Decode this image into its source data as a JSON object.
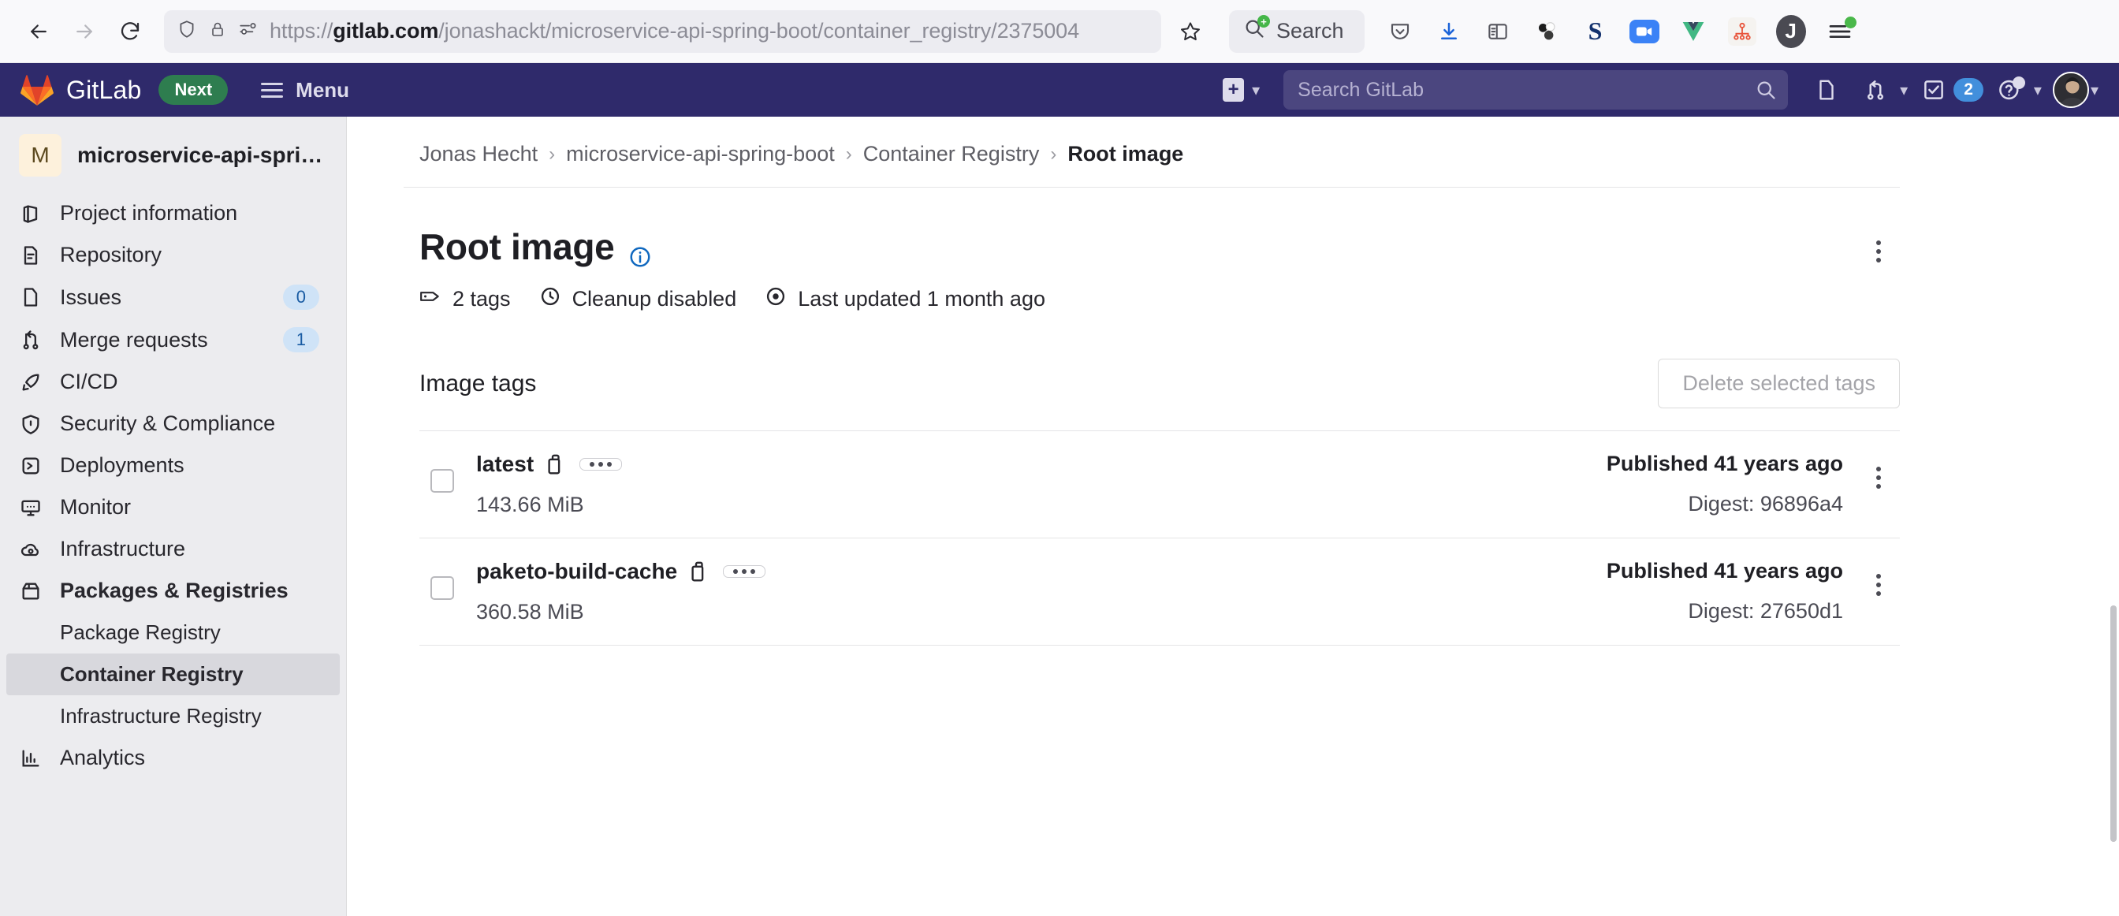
{
  "browser": {
    "url_scheme": "https://",
    "url_host": "gitlab.com",
    "url_path": "/jonashackt/microservice-api-spring-boot/container_registry/2375004",
    "search_placeholder": "Search",
    "icons": {
      "back": "back-arrow-icon",
      "forward": "forward-arrow-icon",
      "reload": "reload-icon",
      "shield": "shield-icon",
      "lock": "lock-icon",
      "reader": "reader-view-icon",
      "bookmark": "star-icon",
      "pocket": "pocket-icon",
      "downloads": "download-icon",
      "sidebar": "sidebar-icon",
      "molecule": "molecule-extension-icon",
      "s_ext": "s-extension-icon",
      "zoom_ext": "zoom-extension-icon",
      "vue_ext": "vue-devtools-icon",
      "gitgraph_ext": "git-graph-extension-icon",
      "profile": "profile-avatar-icon",
      "appmenu": "app-menu-icon"
    },
    "ext_labels": {
      "s": "S",
      "j": "J"
    }
  },
  "gitlab_nav": {
    "brand": "GitLab",
    "next_badge": "Next",
    "menu_label": "Menu",
    "search_placeholder": "Search GitLab",
    "todo_count": "2"
  },
  "sidebar": {
    "project_initial": "M",
    "project_name": "microservice-api-spri…",
    "items": [
      {
        "label": "Project information",
        "icon": "project-information-icon",
        "badge": null,
        "bold": false
      },
      {
        "label": "Repository",
        "icon": "repository-icon",
        "badge": null,
        "bold": false
      },
      {
        "label": "Issues",
        "icon": "issues-icon",
        "badge": "0",
        "bold": false
      },
      {
        "label": "Merge requests",
        "icon": "merge-request-icon",
        "badge": "1",
        "bold": false
      },
      {
        "label": "CI/CD",
        "icon": "rocket-icon",
        "badge": null,
        "bold": false
      },
      {
        "label": "Security & Compliance",
        "icon": "shield-icon",
        "badge": null,
        "bold": false
      },
      {
        "label": "Deployments",
        "icon": "deployments-icon",
        "badge": null,
        "bold": false
      },
      {
        "label": "Monitor",
        "icon": "monitor-icon",
        "badge": null,
        "bold": false
      },
      {
        "label": "Infrastructure",
        "icon": "cloud-gear-icon",
        "badge": null,
        "bold": false
      },
      {
        "label": "Packages & Registries",
        "icon": "package-icon",
        "badge": null,
        "bold": true
      }
    ],
    "sub_items": [
      {
        "label": "Package Registry",
        "active": false
      },
      {
        "label": "Container Registry",
        "active": true
      },
      {
        "label": "Infrastructure Registry",
        "active": false
      }
    ],
    "items_after": [
      {
        "label": "Analytics",
        "icon": "analytics-icon",
        "badge": null,
        "bold": false
      }
    ]
  },
  "breadcrumb": [
    {
      "label": "Jonas Hecht",
      "current": false
    },
    {
      "label": "microservice-api-spring-boot",
      "current": false
    },
    {
      "label": "Container Registry",
      "current": false
    },
    {
      "label": "Root image",
      "current": true
    }
  ],
  "page": {
    "title": "Root image",
    "meta": [
      {
        "label": "2 tags",
        "icon": "tag-icon"
      },
      {
        "label": "Cleanup disabled",
        "icon": "clock-icon"
      },
      {
        "label": "Last updated 1 month ago",
        "icon": "eye-icon"
      }
    ],
    "tags_section_title": "Image tags",
    "delete_button": "Delete selected tags"
  },
  "tags": [
    {
      "name": "latest",
      "size": "143.66 MiB",
      "published": "Published 41 years ago",
      "digest": "Digest: 96896a4"
    },
    {
      "name": "paketo-build-cache",
      "size": "360.58 MiB",
      "published": "Published 41 years ago",
      "digest": "Digest: 27650d1"
    }
  ],
  "colors": {
    "gitlab_navy": "#2f2a6b",
    "next_green": "#2e7d4f",
    "badge_blue": "#428fdc",
    "sidebar_bg": "#ececef",
    "active_item": "#d8d8dd"
  }
}
